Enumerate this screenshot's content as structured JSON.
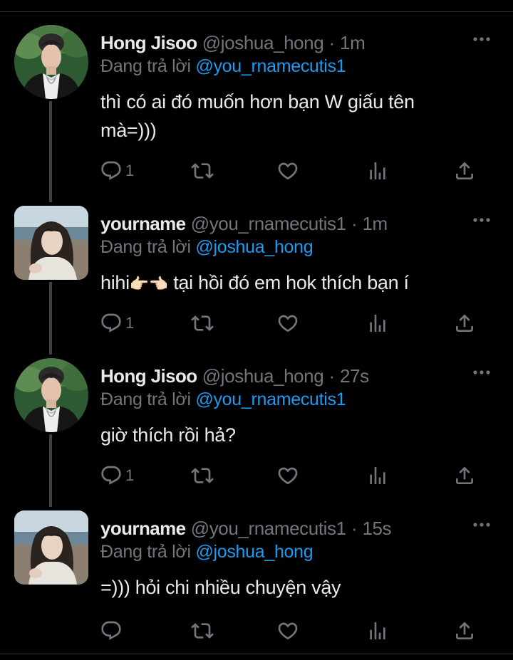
{
  "colors": {
    "background": "#000000",
    "text": "#e7e9ea",
    "muted": "#71767b",
    "link": "#1d9bf0",
    "thread_line": "#3e4144"
  },
  "tweets": [
    {
      "name": "Hong Jisoo",
      "handle": "@joshua_hong",
      "dot": "·",
      "time": "1m",
      "reply_prefix": "Đang trả lời",
      "reply_to": "@you_rnamecutis1",
      "text_1": "thì có ai đó muốn hơn bạn W giấu tên",
      "text_2": "mà=)))",
      "reply_count": "1"
    },
    {
      "name": "yourname",
      "handle": "@you_rnamecutis1",
      "dot": "·",
      "time": "1m",
      "reply_prefix": "Đang trả lời",
      "reply_to": "@joshua_hong",
      "text_a": "hihi",
      "emoji": "👉🏻👈🏻",
      "text_b": " tại hồi đó em hok thích bạn í",
      "reply_count": "1"
    },
    {
      "name": "Hong Jisoo",
      "handle": "@joshua_hong",
      "dot": "·",
      "time": "27s",
      "reply_prefix": "Đang trả lời",
      "reply_to": "@you_rnamecutis1",
      "text_1": "giờ thích rồi hả?",
      "reply_count": "1"
    },
    {
      "name": "yourname",
      "handle": "@you_rnamecutis1",
      "dot": "·",
      "time": "15s",
      "reply_prefix": "Đang trả lời",
      "reply_to": "@joshua_hong",
      "text_1": "=))) hỏi chi nhiều chuyện vậy",
      "reply_count": ""
    }
  ],
  "icons": {
    "reply": "reply-icon",
    "retweet": "retweet-icon",
    "like": "heart-icon",
    "views": "analytics-icon",
    "share": "share-icon",
    "more": "more-icon"
  }
}
